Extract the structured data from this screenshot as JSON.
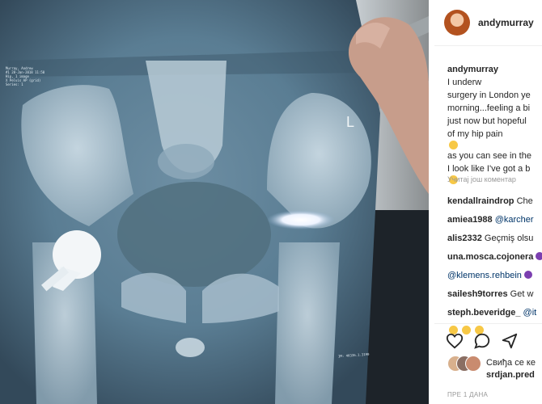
{
  "post": {
    "username": "andymurray",
    "avatar_icon": "user-avatar",
    "caption": {
      "username": "andymurray",
      "lines": [
        "I underw",
        "surgery in London ye",
        "morning...feeling a bi",
        "just now but hopeful",
        "of my hip pain",
        "as you can see in the",
        "I look like I've got a b"
      ]
    },
    "load_more": "Учитај још коментар",
    "comments": [
      {
        "user": "kendallraindrop",
        "text": "Che"
      },
      {
        "user": "amiea1988",
        "text": "@karcher"
      },
      {
        "user": "alis2332",
        "text": "Geçmiş olsu"
      },
      {
        "user": "una.mosca.cojonera",
        "text": ""
      },
      {
        "user": "",
        "text": "@klemens.rehbein"
      },
      {
        "user": "sailesh9torres",
        "text": "Get w"
      },
      {
        "user": "steph.beveridge_",
        "text": "@it"
      }
    ],
    "likes_text": "Свиђа се ке",
    "likes_user": "srdjan.pred",
    "date": "ПРЕ 1 ДАНА"
  },
  "xray": {
    "side_marker": "L",
    "patient_label_lines": [
      "Murray, Andrew",
      "#1  28-Jan-2018  11:50",
      "Hip, 1 image",
      "X Pelvis AP (grid)",
      "Series: 1"
    ],
    "bottom_label": "IM: 40336.1.3190"
  },
  "colors": {
    "accent": "#3897f0",
    "text": "#262626",
    "muted": "#999999",
    "mention": "#003569"
  }
}
